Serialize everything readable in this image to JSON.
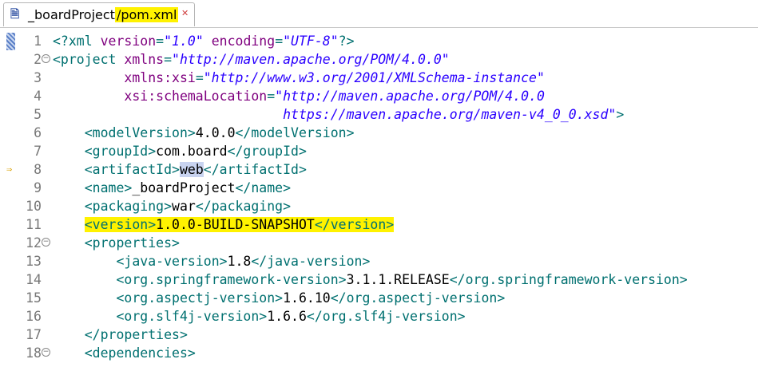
{
  "tab": {
    "project": "_boardProject",
    "separator": "/",
    "file": "pom.xml",
    "close_symbol": "✕"
  },
  "lines": [
    {
      "n": "1",
      "parts": [
        [
          "tag",
          "<?xml "
        ],
        [
          "attr",
          "version"
        ],
        [
          "tag",
          "="
        ],
        [
          "str",
          "\"1.0\""
        ],
        [
          "tag",
          " "
        ],
        [
          "attr",
          "encoding"
        ],
        [
          "tag",
          "="
        ],
        [
          "str",
          "\"UTF-8\""
        ],
        [
          "tag",
          "?>"
        ]
      ]
    },
    {
      "n": "2",
      "fold": true,
      "parts": [
        [
          "tag",
          "<project "
        ],
        [
          "attr",
          "xmlns"
        ],
        [
          "tag",
          "="
        ],
        [
          "str",
          "\"http://maven.apache.org/POM/4.0.0\""
        ]
      ]
    },
    {
      "n": "3",
      "parts": [
        [
          "txt",
          "         "
        ],
        [
          "attr",
          "xmlns:xsi"
        ],
        [
          "tag",
          "="
        ],
        [
          "str",
          "\"http://www.w3.org/2001/XMLSchema-instance\""
        ]
      ]
    },
    {
      "n": "4",
      "parts": [
        [
          "txt",
          "         "
        ],
        [
          "attr",
          "xsi:schemaLocation"
        ],
        [
          "tag",
          "="
        ],
        [
          "str",
          "\"http://maven.apache.org/POM/4.0.0"
        ]
      ]
    },
    {
      "n": "5",
      "parts": [
        [
          "txt",
          "                             "
        ],
        [
          "str",
          "https://maven.apache.org/maven-v4_0_0.xsd\""
        ],
        [
          "tag",
          ">"
        ]
      ]
    },
    {
      "n": "6",
      "parts": [
        [
          "txt",
          "    "
        ],
        [
          "tag",
          "<modelVersion>"
        ],
        [
          "txt",
          "4.0.0"
        ],
        [
          "tag",
          "</modelVersion>"
        ]
      ]
    },
    {
      "n": "7",
      "parts": [
        [
          "txt",
          "    "
        ],
        [
          "tag",
          "<groupId>"
        ],
        [
          "txt",
          "com.board"
        ],
        [
          "tag",
          "</groupId>"
        ]
      ]
    },
    {
      "n": "8",
      "parts": [
        [
          "txt",
          "    "
        ],
        [
          "tag",
          "<artifactId>"
        ],
        [
          "txt-hl",
          "web"
        ],
        [
          "tag",
          "</artifactId>"
        ]
      ]
    },
    {
      "n": "9",
      "parts": [
        [
          "txt",
          "    "
        ],
        [
          "tag",
          "<name>"
        ],
        [
          "txt",
          "_boardProject"
        ],
        [
          "tag",
          "</name>"
        ]
      ]
    },
    {
      "n": "10",
      "parts": [
        [
          "txt",
          "    "
        ],
        [
          "tag",
          "<packaging>"
        ],
        [
          "txt",
          "war"
        ],
        [
          "tag",
          "</packaging>"
        ]
      ]
    },
    {
      "n": "11",
      "highlight": true,
      "parts": [
        [
          "txt",
          "    "
        ],
        [
          "tag",
          "<version>"
        ],
        [
          "txt",
          "1.0.0-BUILD-SNAPSHOT"
        ],
        [
          "tag",
          "</version>"
        ]
      ]
    },
    {
      "n": "12",
      "fold": true,
      "parts": [
        [
          "txt",
          "    "
        ],
        [
          "tag",
          "<properties>"
        ]
      ]
    },
    {
      "n": "13",
      "parts": [
        [
          "txt",
          "        "
        ],
        [
          "tag",
          "<java-version>"
        ],
        [
          "txt",
          "1.8"
        ],
        [
          "tag",
          "</java-version>"
        ]
      ]
    },
    {
      "n": "14",
      "parts": [
        [
          "txt",
          "        "
        ],
        [
          "tag",
          "<org.springframework-version>"
        ],
        [
          "txt",
          "3.1.1.RELEASE"
        ],
        [
          "tag",
          "</org.springframework-version>"
        ]
      ]
    },
    {
      "n": "15",
      "parts": [
        [
          "txt",
          "        "
        ],
        [
          "tag",
          "<org.aspectj-version>"
        ],
        [
          "txt",
          "1.6.10"
        ],
        [
          "tag",
          "</org.aspectj-version>"
        ]
      ]
    },
    {
      "n": "16",
      "parts": [
        [
          "txt",
          "        "
        ],
        [
          "tag",
          "<org.slf4j-version>"
        ],
        [
          "txt",
          "1.6.6"
        ],
        [
          "tag",
          "</org.slf4j-version>"
        ]
      ]
    },
    {
      "n": "17",
      "parts": [
        [
          "txt",
          "    "
        ],
        [
          "tag",
          "</properties>"
        ]
      ]
    },
    {
      "n": "18",
      "fold": true,
      "parts": [
        [
          "txt",
          "    "
        ],
        [
          "tag",
          "<dependencies>"
        ]
      ]
    }
  ],
  "colors": {
    "tag": "#007070",
    "attribute": "#7f007f",
    "string": "#2a00ff",
    "highlight": "#fff200"
  }
}
